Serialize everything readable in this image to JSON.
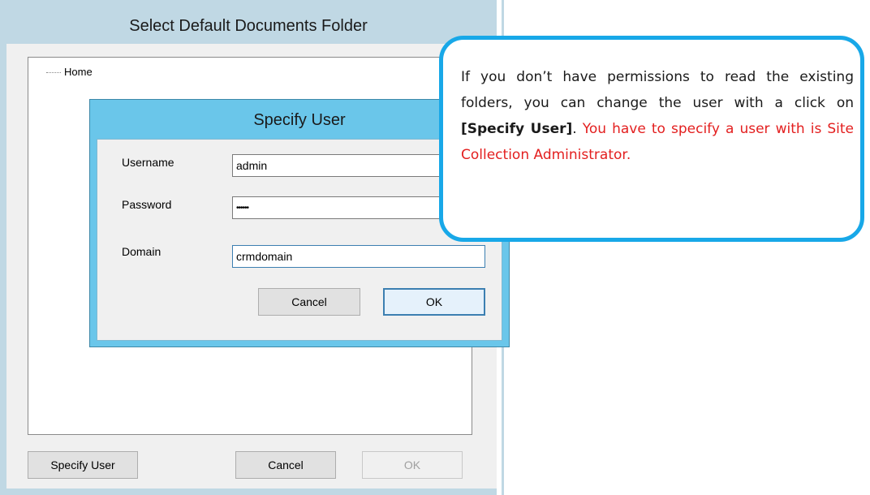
{
  "outer_dialog": {
    "title": "Select Default Documents Folder",
    "tree": {
      "root_label": "Home"
    },
    "buttons": {
      "specify_user": "Specify User",
      "cancel": "Cancel",
      "ok": "OK"
    }
  },
  "inner_dialog": {
    "title": "Specify User",
    "fields": {
      "username": {
        "label": "Username",
        "value": "admin"
      },
      "password": {
        "label": "Password",
        "value": "••••••"
      },
      "domain": {
        "label": "Domain",
        "value": "crmdomain"
      }
    },
    "buttons": {
      "cancel": "Cancel",
      "ok": "OK"
    }
  },
  "callout": {
    "text_part1": "If you don’t have permissions to read the existing folders, you can change the user with a click on ",
    "bold_text": "[Specify User]",
    "text_part2": ". ",
    "red_text": "You have to specify a user with is Site Collection Administrator.",
    "colors": {
      "border": "#18a8e8",
      "emphasis": "#e31f1f"
    }
  }
}
